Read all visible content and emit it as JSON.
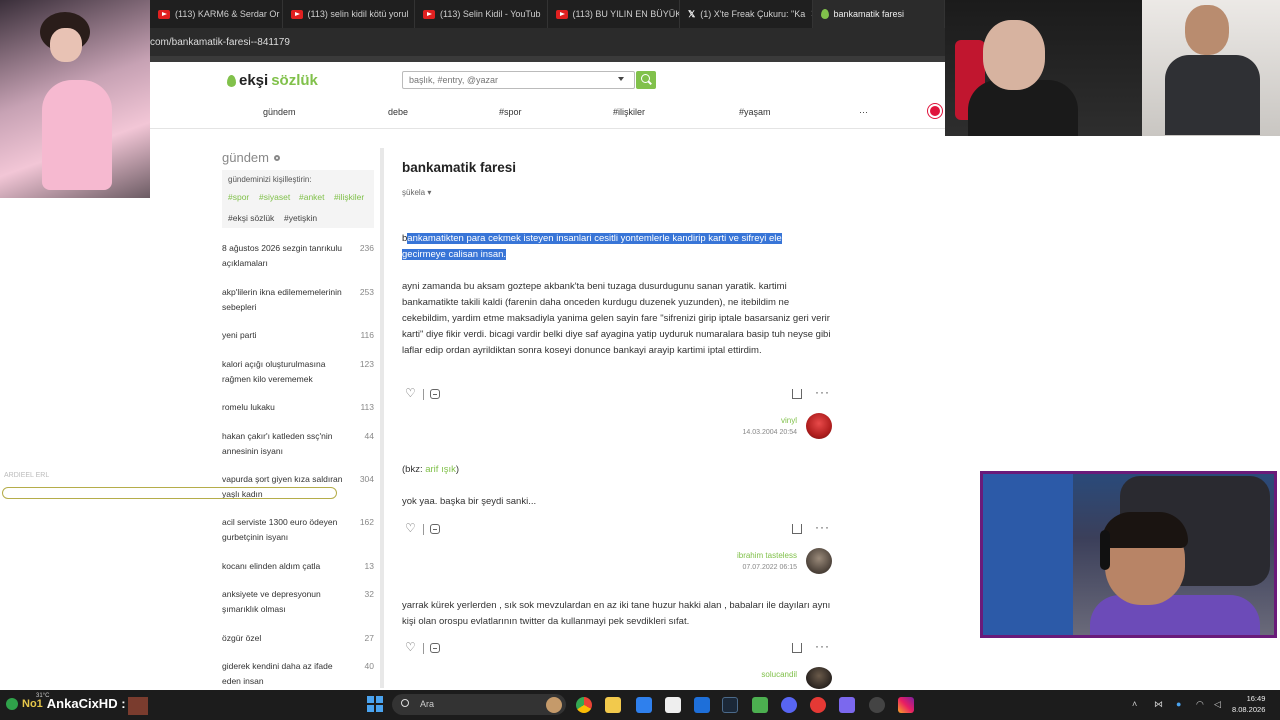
{
  "browser": {
    "tabs": [
      {
        "label": "(113) KARM6 & Serdar Or"
      },
      {
        "label": "(113) selin kidil kötü yorul"
      },
      {
        "label": "(113) Selin Kidil - YouTub"
      },
      {
        "label": "(113) BU YILIN EN BÜYÜK"
      },
      {
        "label": "(1) X'te Freak Çukuru: \"Ka"
      },
      {
        "label": "bankamatik faresi"
      }
    ],
    "address": "com/bankamatik-faresi--841179"
  },
  "site": {
    "logo_prefix": "ekşi",
    "logo_suffix": "sözlük",
    "search_placeholder": "başlık, #entry, @yazar",
    "nav": [
      "gündem",
      "debe",
      "#spor",
      "#ilişkiler",
      "#yaşam",
      "···"
    ]
  },
  "sidebar": {
    "title": "gündem",
    "personalize_text": "gündeminizi kişilleştirin:",
    "tags_green": [
      "#spor",
      "#siyaset",
      "#anket",
      "#ilişkiler"
    ],
    "tags_dark": [
      "#ekşi sözlük",
      "#yetişkin"
    ],
    "items": [
      {
        "title": "8 ağustos 2026 sezgin tanrıkulu açıklamaları",
        "count": "236"
      },
      {
        "title": "akp'lilerin ikna edilememelerinin sebepleri",
        "count": "253"
      },
      {
        "title": "yeni parti",
        "count": "116"
      },
      {
        "title": "kalori açığı oluşturulmasına rağmen kilo verememek",
        "count": "123"
      },
      {
        "title": "romelu lukaku",
        "count": "113"
      },
      {
        "title": "hakan çakır'ı katleden ssç'nin annesinin isyanı",
        "count": "44"
      },
      {
        "title": "vapurda şort giyen kıza saldıran yaşlı kadın",
        "count": "304"
      },
      {
        "title": "acil serviste 1300 euro ödeyen gurbetçinin isyanı",
        "count": "162"
      },
      {
        "title": "kocanı elinden aldım çatla",
        "count": "13"
      },
      {
        "title": "anksiyete ve depresyonun şımarıklık olması",
        "count": "32"
      },
      {
        "title": "özgür özel",
        "count": "27"
      },
      {
        "title": "giderek kendini daha az ifade eden insan",
        "count": "40"
      }
    ]
  },
  "topic": {
    "title": "bankamatik faresi",
    "sort_label": "şükela ▾",
    "definition_first": "b",
    "definition_highlighted": "ankamatikten para cekmek isteyen insanlari cesitli yontemlerle kandirip karti ve sifreyi ele gecirmeye calisan insan.",
    "entries": [
      {
        "text": "ayni zamanda bu aksam goztepe akbank'ta beni tuzaga dusurdugunu sanan yaratik. kartimi bankamatikte takili kaldi (farenin daha onceden kurdugu duzenek yuzunden), ne itebildim ne cekebildim, yardim etme maksadiyla yanima gelen sayin fare \"sifrenizi girip iptale basarsaniz geri verir karti\" diye fikir verdi. bicagi vardir belki diye saf ayagina yatip uyduruk numaralara basip tuh neyse gibi laflar edip ordan ayrildiktan sonra koseyi donunce bankayi arayip kartimi iptal ettirdim.",
        "author": "vinyl",
        "date": "14.03.2004 20:54"
      },
      {
        "bkz_prefix": "(bkz: ",
        "bkz_link": "arif ışık",
        "bkz_suffix": ")",
        "text": "yok yaa. başka bir şeydi sanki...",
        "author": "ibrahim tasteless",
        "date": "07.07.2022 06:15"
      },
      {
        "text": "yarrak kürek yerlerden , sık sok mevzulardan en az iki tane huzur hakki alan , babaları ile dayıları aynı kişi olan orospu evlatlarının twitter da kullanmayi pek sevdikleri sıfat.",
        "author": "solucandil",
        "date": ""
      }
    ]
  },
  "overlay": {
    "alert_text": "ARDIEEL ERL",
    "streamer_name": "AnkaCixHD :",
    "badge": "No1",
    "temp": "31°C"
  },
  "taskbar": {
    "search": "Ara",
    "time": "16:49",
    "date": "8.08.2026"
  },
  "colors": {
    "brand_green": "#81c14b",
    "selection_blue": "#3875d7",
    "stream_frame": "#6a1b7a"
  }
}
